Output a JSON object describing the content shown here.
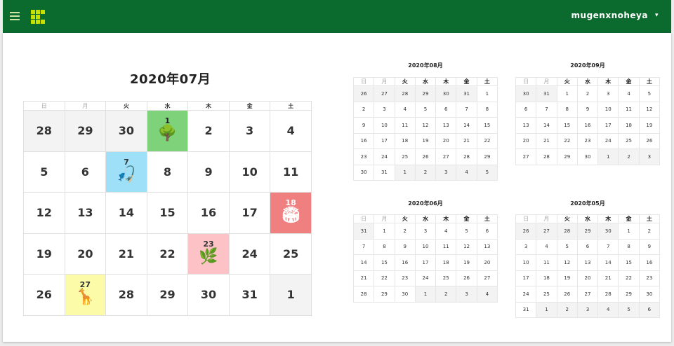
{
  "header": {
    "username": "mugenxnoheya",
    "chevron": "▾",
    "accent_color": "#0b6b2e"
  },
  "weekdays": [
    "日",
    "月",
    "火",
    "水",
    "木",
    "金",
    "土"
  ],
  "main": {
    "title": "2020年07月",
    "weeks": [
      [
        {
          "d": "28",
          "o": true
        },
        {
          "d": "29",
          "o": true
        },
        {
          "d": "30",
          "o": true
        },
        {
          "d": "1",
          "ev": "ev-green",
          "icon": "tree-bench-icon",
          "glyph": "🌳"
        },
        {
          "d": "2"
        },
        {
          "d": "3"
        },
        {
          "d": "4"
        }
      ],
      [
        {
          "d": "5"
        },
        {
          "d": "6"
        },
        {
          "d": "7",
          "ev": "ev-blue",
          "icon": "fishing-icon",
          "glyph": "🎣"
        },
        {
          "d": "8"
        },
        {
          "d": "9"
        },
        {
          "d": "10"
        },
        {
          "d": "11"
        }
      ],
      [
        {
          "d": "12"
        },
        {
          "d": "13"
        },
        {
          "d": "14"
        },
        {
          "d": "15"
        },
        {
          "d": "16"
        },
        {
          "d": "17"
        },
        {
          "d": "18",
          "ev": "ev-red",
          "icon": "stadium-icon",
          "glyph": "🏟"
        }
      ],
      [
        {
          "d": "19"
        },
        {
          "d": "20"
        },
        {
          "d": "21"
        },
        {
          "d": "22"
        },
        {
          "d": "23",
          "ev": "ev-pink",
          "icon": "branch-icon",
          "glyph": "🌿"
        },
        {
          "d": "24"
        },
        {
          "d": "25"
        }
      ],
      [
        {
          "d": "26"
        },
        {
          "d": "27",
          "ev": "ev-yellow",
          "icon": "giraffe-icon",
          "glyph": "🦒"
        },
        {
          "d": "28"
        },
        {
          "d": "29"
        },
        {
          "d": "30"
        },
        {
          "d": "31"
        },
        {
          "d": "1",
          "o": true
        }
      ]
    ]
  },
  "mini_calendars": [
    {
      "title": "2020年08月",
      "rows": [
        [
          {
            "d": "26",
            "o": true
          },
          {
            "d": "27",
            "o": true
          },
          {
            "d": "28",
            "o": true
          },
          {
            "d": "29",
            "o": true
          },
          {
            "d": "30",
            "o": true
          },
          {
            "d": "31",
            "o": true
          },
          {
            "d": "1"
          }
        ],
        [
          {
            "d": "2"
          },
          {
            "d": "3"
          },
          {
            "d": "4"
          },
          {
            "d": "5"
          },
          {
            "d": "6"
          },
          {
            "d": "7"
          },
          {
            "d": "8"
          }
        ],
        [
          {
            "d": "9"
          },
          {
            "d": "10"
          },
          {
            "d": "11"
          },
          {
            "d": "12"
          },
          {
            "d": "13"
          },
          {
            "d": "14"
          },
          {
            "d": "15"
          }
        ],
        [
          {
            "d": "16"
          },
          {
            "d": "17"
          },
          {
            "d": "18"
          },
          {
            "d": "19"
          },
          {
            "d": "20"
          },
          {
            "d": "21"
          },
          {
            "d": "22"
          }
        ],
        [
          {
            "d": "23"
          },
          {
            "d": "24"
          },
          {
            "d": "25"
          },
          {
            "d": "26"
          },
          {
            "d": "27"
          },
          {
            "d": "28"
          },
          {
            "d": "29"
          }
        ],
        [
          {
            "d": "30"
          },
          {
            "d": "31"
          },
          {
            "d": "1",
            "o": true
          },
          {
            "d": "2",
            "o": true
          },
          {
            "d": "3",
            "o": true
          },
          {
            "d": "4",
            "o": true
          },
          {
            "d": "5",
            "o": true
          }
        ]
      ]
    },
    {
      "title": "2020年09月",
      "rows": [
        [
          {
            "d": "30",
            "o": true
          },
          {
            "d": "31",
            "o": true
          },
          {
            "d": "1"
          },
          {
            "d": "2"
          },
          {
            "d": "3"
          },
          {
            "d": "4"
          },
          {
            "d": "5"
          }
        ],
        [
          {
            "d": "6"
          },
          {
            "d": "7"
          },
          {
            "d": "8"
          },
          {
            "d": "9"
          },
          {
            "d": "10"
          },
          {
            "d": "11"
          },
          {
            "d": "12"
          }
        ],
        [
          {
            "d": "13"
          },
          {
            "d": "14"
          },
          {
            "d": "15"
          },
          {
            "d": "16"
          },
          {
            "d": "17"
          },
          {
            "d": "18"
          },
          {
            "d": "19"
          }
        ],
        [
          {
            "d": "20"
          },
          {
            "d": "21"
          },
          {
            "d": "22"
          },
          {
            "d": "23"
          },
          {
            "d": "24"
          },
          {
            "d": "25"
          },
          {
            "d": "26"
          }
        ],
        [
          {
            "d": "27"
          },
          {
            "d": "28"
          },
          {
            "d": "29"
          },
          {
            "d": "30"
          },
          {
            "d": "1",
            "o": true
          },
          {
            "d": "2",
            "o": true
          },
          {
            "d": "3",
            "o": true
          }
        ]
      ]
    },
    {
      "title": "2020年06月",
      "rows": [
        [
          {
            "d": "31",
            "o": true
          },
          {
            "d": "1"
          },
          {
            "d": "2"
          },
          {
            "d": "3"
          },
          {
            "d": "4"
          },
          {
            "d": "5"
          },
          {
            "d": "6"
          }
        ],
        [
          {
            "d": "7"
          },
          {
            "d": "8"
          },
          {
            "d": "9"
          },
          {
            "d": "10"
          },
          {
            "d": "11"
          },
          {
            "d": "12"
          },
          {
            "d": "13"
          }
        ],
        [
          {
            "d": "14"
          },
          {
            "d": "15"
          },
          {
            "d": "16"
          },
          {
            "d": "17"
          },
          {
            "d": "18"
          },
          {
            "d": "19"
          },
          {
            "d": "20"
          }
        ],
        [
          {
            "d": "21"
          },
          {
            "d": "22"
          },
          {
            "d": "23"
          },
          {
            "d": "24"
          },
          {
            "d": "25"
          },
          {
            "d": "26"
          },
          {
            "d": "27"
          }
        ],
        [
          {
            "d": "28"
          },
          {
            "d": "29"
          },
          {
            "d": "30"
          },
          {
            "d": "1",
            "o": true
          },
          {
            "d": "2",
            "o": true
          },
          {
            "d": "3",
            "o": true
          },
          {
            "d": "4",
            "o": true
          }
        ]
      ]
    },
    {
      "title": "2020年05月",
      "rows": [
        [
          {
            "d": "26",
            "o": true
          },
          {
            "d": "27",
            "o": true
          },
          {
            "d": "28",
            "o": true
          },
          {
            "d": "29",
            "o": true
          },
          {
            "d": "30",
            "o": true
          },
          {
            "d": "1"
          },
          {
            "d": "2"
          }
        ],
        [
          {
            "d": "3"
          },
          {
            "d": "4"
          },
          {
            "d": "5"
          },
          {
            "d": "6"
          },
          {
            "d": "7"
          },
          {
            "d": "8"
          },
          {
            "d": "9"
          }
        ],
        [
          {
            "d": "10"
          },
          {
            "d": "11"
          },
          {
            "d": "12"
          },
          {
            "d": "13"
          },
          {
            "d": "14"
          },
          {
            "d": "15"
          },
          {
            "d": "16"
          }
        ],
        [
          {
            "d": "17"
          },
          {
            "d": "18"
          },
          {
            "d": "19"
          },
          {
            "d": "20"
          },
          {
            "d": "21"
          },
          {
            "d": "22"
          },
          {
            "d": "23"
          }
        ],
        [
          {
            "d": "24"
          },
          {
            "d": "25"
          },
          {
            "d": "26"
          },
          {
            "d": "27"
          },
          {
            "d": "28"
          },
          {
            "d": "29"
          },
          {
            "d": "30"
          }
        ],
        [
          {
            "d": "31"
          },
          {
            "d": "1",
            "o": true
          },
          {
            "d": "2",
            "o": true
          },
          {
            "d": "3",
            "o": true
          },
          {
            "d": "4",
            "o": true
          },
          {
            "d": "5",
            "o": true
          },
          {
            "d": "6",
            "o": true
          }
        ]
      ]
    }
  ]
}
